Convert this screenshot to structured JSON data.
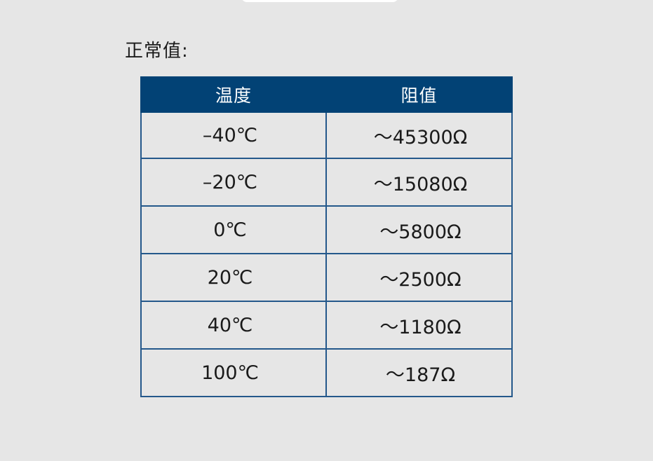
{
  "section_title": "正常值:",
  "table": {
    "headers": [
      "温度",
      "阻值"
    ],
    "rows": [
      {
        "temperature": "–40℃",
        "resistance": "～45300Ω"
      },
      {
        "temperature": "–20℃",
        "resistance": "～15080Ω"
      },
      {
        "temperature": "0℃",
        "resistance": "～5800Ω"
      },
      {
        "temperature": "20℃",
        "resistance": "～2500Ω"
      },
      {
        "temperature": "40℃",
        "resistance": "～1180Ω"
      },
      {
        "temperature": "100℃",
        "resistance": "～187Ω"
      }
    ]
  },
  "colors": {
    "background": "#e6e6e6",
    "header_fill": "#024275",
    "grid_line": "#24588b"
  }
}
